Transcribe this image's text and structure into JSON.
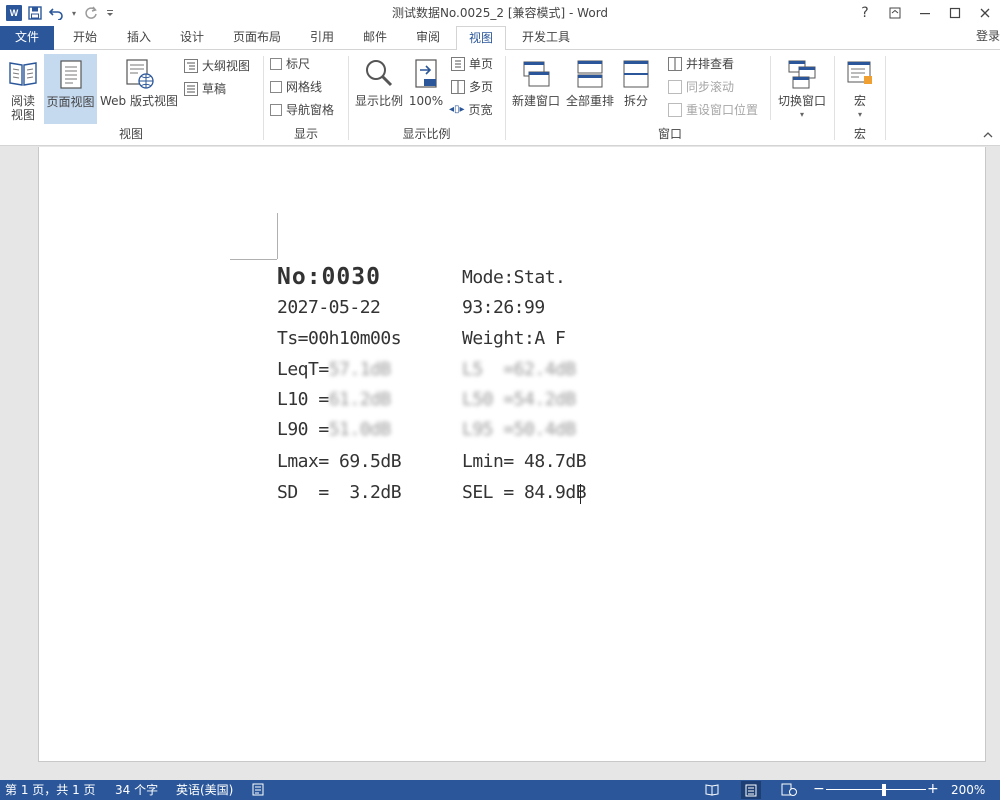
{
  "window": {
    "title": "测试数据No.0025_2 [兼容模式] - Word",
    "help": "?",
    "ribbon_display": "⊡",
    "minimize": "—",
    "maximize": "☐",
    "close": "✕"
  },
  "qat": {
    "app_icon": "W",
    "save_icon": "save-icon",
    "undo_icon": "undo-icon",
    "redo_icon": "redo-icon",
    "customize_icon": "customize-qat-icon"
  },
  "tabs": [
    "文件",
    "开始",
    "插入",
    "设计",
    "页面布局",
    "引用",
    "邮件",
    "审阅",
    "视图",
    "开发工具"
  ],
  "login_label": "登录",
  "ribbon": {
    "views": {
      "read_mode": "阅读\n视图",
      "read_mode_l1": "阅读",
      "read_mode_l2": "视图",
      "print_layout": "页面视图",
      "web_layout": "Web 版式视图",
      "outline": "大纲视图",
      "draft": "草稿",
      "group_label": "视图"
    },
    "show": {
      "ruler": "标尺",
      "gridlines": "网格线",
      "nav_pane": "导航窗格",
      "group_label": "显示"
    },
    "zoom": {
      "zoom": "显示比例",
      "hundred": "100%",
      "one_page": "单页",
      "multi_page": "多页",
      "page_width": "页宽",
      "group_label": "显示比例"
    },
    "window": {
      "new_window": "新建窗口",
      "arrange_all": "全部重排",
      "split": "拆分",
      "side_by_side": "并排查看",
      "sync_scroll": "同步滚动",
      "reset_position": "重设窗口位置",
      "switch_windows": "切换窗口",
      "group_label": "窗口"
    },
    "macros": {
      "macros": "宏",
      "group_label": "宏"
    }
  },
  "document": {
    "line1_left": "No:0030",
    "line1_right": "Mode:Stat.",
    "line2_left": "2027-05-22",
    "line2_right": "93:26:99",
    "line3_left": "Ts=00h10m00s",
    "line3_right": "Weight:A F",
    "line4_left_label": "LeqT=",
    "line4_left_value": "57.1dB",
    "line4_right_label": "L5  =",
    "line4_right_value": "62.4dB",
    "line5_left_label": "L10 =",
    "line5_left_value": "61.2dB",
    "line5_right_label": "L50 =",
    "line5_right_value": "54.2dB",
    "line6_left_label": "L90 =",
    "line6_left_value": "51.0dB",
    "line6_right_label": "L95 =",
    "line6_right_value": "50.4dB",
    "line4_right_suffix": ".4dB",
    "line5_right_suffix": ".2dB",
    "line6_right_suffix": ".4dB",
    "line7_left": "Lmax= 69.5dB",
    "line7_right": "Lmin= 48.7dB",
    "line8_left": "SD  =  3.2dB",
    "line8_right": "SEL = 84.9dB"
  },
  "status": {
    "page": "第 1 页，共 1 页",
    "words": "34 个字",
    "language": "英语(美国)",
    "zoom_minus": "−",
    "zoom_plus": "+",
    "zoom": "200%"
  },
  "colors": {
    "accent": "#2b579a",
    "selected": "#c5d9ef"
  }
}
